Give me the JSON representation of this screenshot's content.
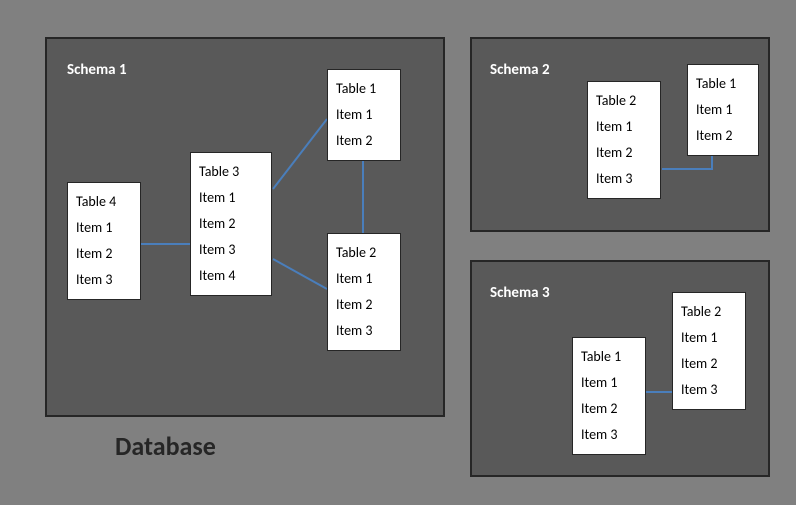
{
  "database_label": "Database",
  "schemas": [
    {
      "title": "Schema 1",
      "tables": [
        {
          "name": "Table 4",
          "items": [
            "Item 1",
            "Item 2",
            "Item 3"
          ]
        },
        {
          "name": "Table 3",
          "items": [
            "Item 1",
            "Item 2",
            "Item 3",
            "Item 4"
          ]
        },
        {
          "name": "Table 1",
          "items": [
            "Item 1",
            "Item 2"
          ]
        },
        {
          "name": "Table 2",
          "items": [
            "Item 1",
            "Item 2",
            "Item 3"
          ]
        }
      ]
    },
    {
      "title": "Schema 2",
      "tables": [
        {
          "name": "Table 2",
          "items": [
            "Item 1",
            "Item 2",
            "Item 3"
          ]
        },
        {
          "name": "Table 1",
          "items": [
            "Item 1",
            "Item 2"
          ]
        }
      ]
    },
    {
      "title": "Schema 3",
      "tables": [
        {
          "name": "Table 1",
          "items": [
            "Item 1",
            "Item 2",
            "Item 3"
          ]
        },
        {
          "name": "Table 2",
          "items": [
            "Item 1",
            "Item 2",
            "Item 3"
          ]
        }
      ]
    }
  ]
}
